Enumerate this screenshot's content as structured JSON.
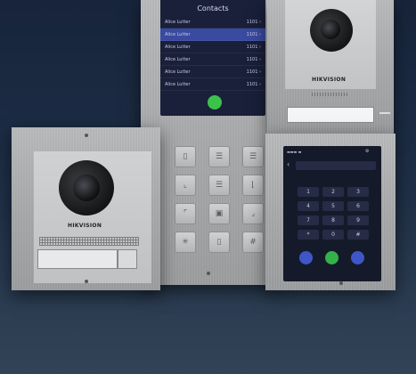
{
  "contacts_screen": {
    "title": "Contacts",
    "rows": [
      {
        "name": "Alice Lutter",
        "num": "1101"
      },
      {
        "name": "Alice Lutter",
        "num": "1101"
      },
      {
        "name": "Alice Lutter",
        "num": "1101"
      },
      {
        "name": "Alice Lutter",
        "num": "1101"
      },
      {
        "name": "Alice Lutter",
        "num": "1101"
      },
      {
        "name": "Alice Lutter",
        "num": "1101"
      }
    ],
    "selected_row": 1,
    "call_color": "#3cc24a"
  },
  "brand": {
    "logo": "HIKVISION"
  },
  "touch_screen": {
    "keys": [
      "1",
      "2",
      "3",
      "4",
      "5",
      "6",
      "7",
      "8",
      "9",
      "*",
      "0",
      "#"
    ],
    "buttons": [
      {
        "name": "user-icon",
        "color": "#3f56c8"
      },
      {
        "name": "phone-icon",
        "color": "#33b24a"
      },
      {
        "name": "contacts-icon",
        "color": "#3f56c8"
      }
    ]
  },
  "colors": {
    "background": "#1d2d45",
    "steel": "#a8aaac",
    "screen": "#1a1f3a",
    "selection": "#3a4aa0"
  }
}
